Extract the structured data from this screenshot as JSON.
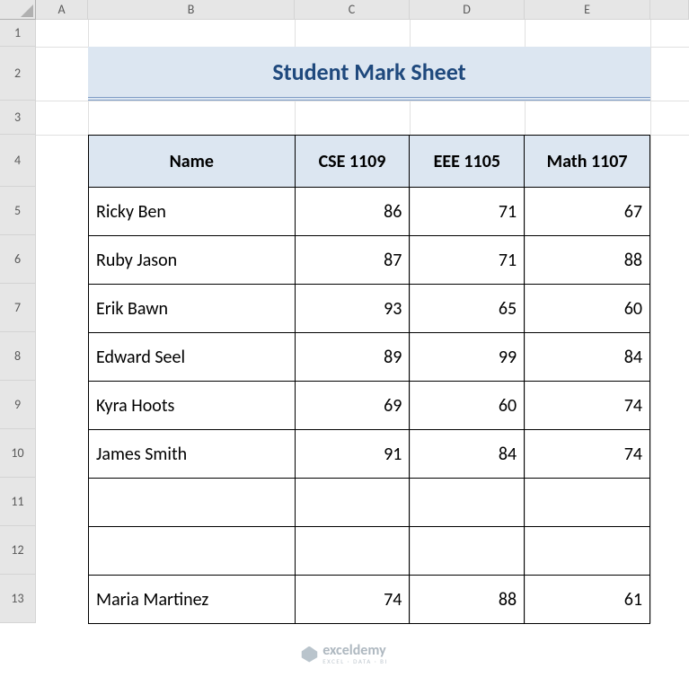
{
  "columns": [
    "A",
    "B",
    "C",
    "D",
    "E"
  ],
  "rows": [
    "1",
    "2",
    "3",
    "4",
    "5",
    "6",
    "7",
    "8",
    "9",
    "10",
    "11",
    "12",
    "13"
  ],
  "title": "Student Mark Sheet",
  "headers": {
    "name": "Name",
    "c": "CSE 1109",
    "d": "EEE 1105",
    "e": "Math 1107"
  },
  "data": [
    {
      "name": "Ricky Ben",
      "c": "86",
      "d": "71",
      "e": "67"
    },
    {
      "name": "Ruby Jason",
      "c": "87",
      "d": "71",
      "e": "88"
    },
    {
      "name": "Erik Bawn",
      "c": "93",
      "d": "65",
      "e": "60"
    },
    {
      "name": "Edward Seel",
      "c": "89",
      "d": "99",
      "e": "84"
    },
    {
      "name": "Kyra Hoots",
      "c": "69",
      "d": "60",
      "e": "74"
    },
    {
      "name": "James Smith",
      "c": "91",
      "d": "84",
      "e": "74"
    },
    {
      "name": "",
      "c": "",
      "d": "",
      "e": ""
    },
    {
      "name": "",
      "c": "",
      "d": "",
      "e": ""
    },
    {
      "name": "Maria Martinez",
      "c": "74",
      "d": "88",
      "e": "61"
    }
  ],
  "watermark": {
    "main": "exceldemy",
    "sub": "EXCEL · DATA · BI"
  }
}
